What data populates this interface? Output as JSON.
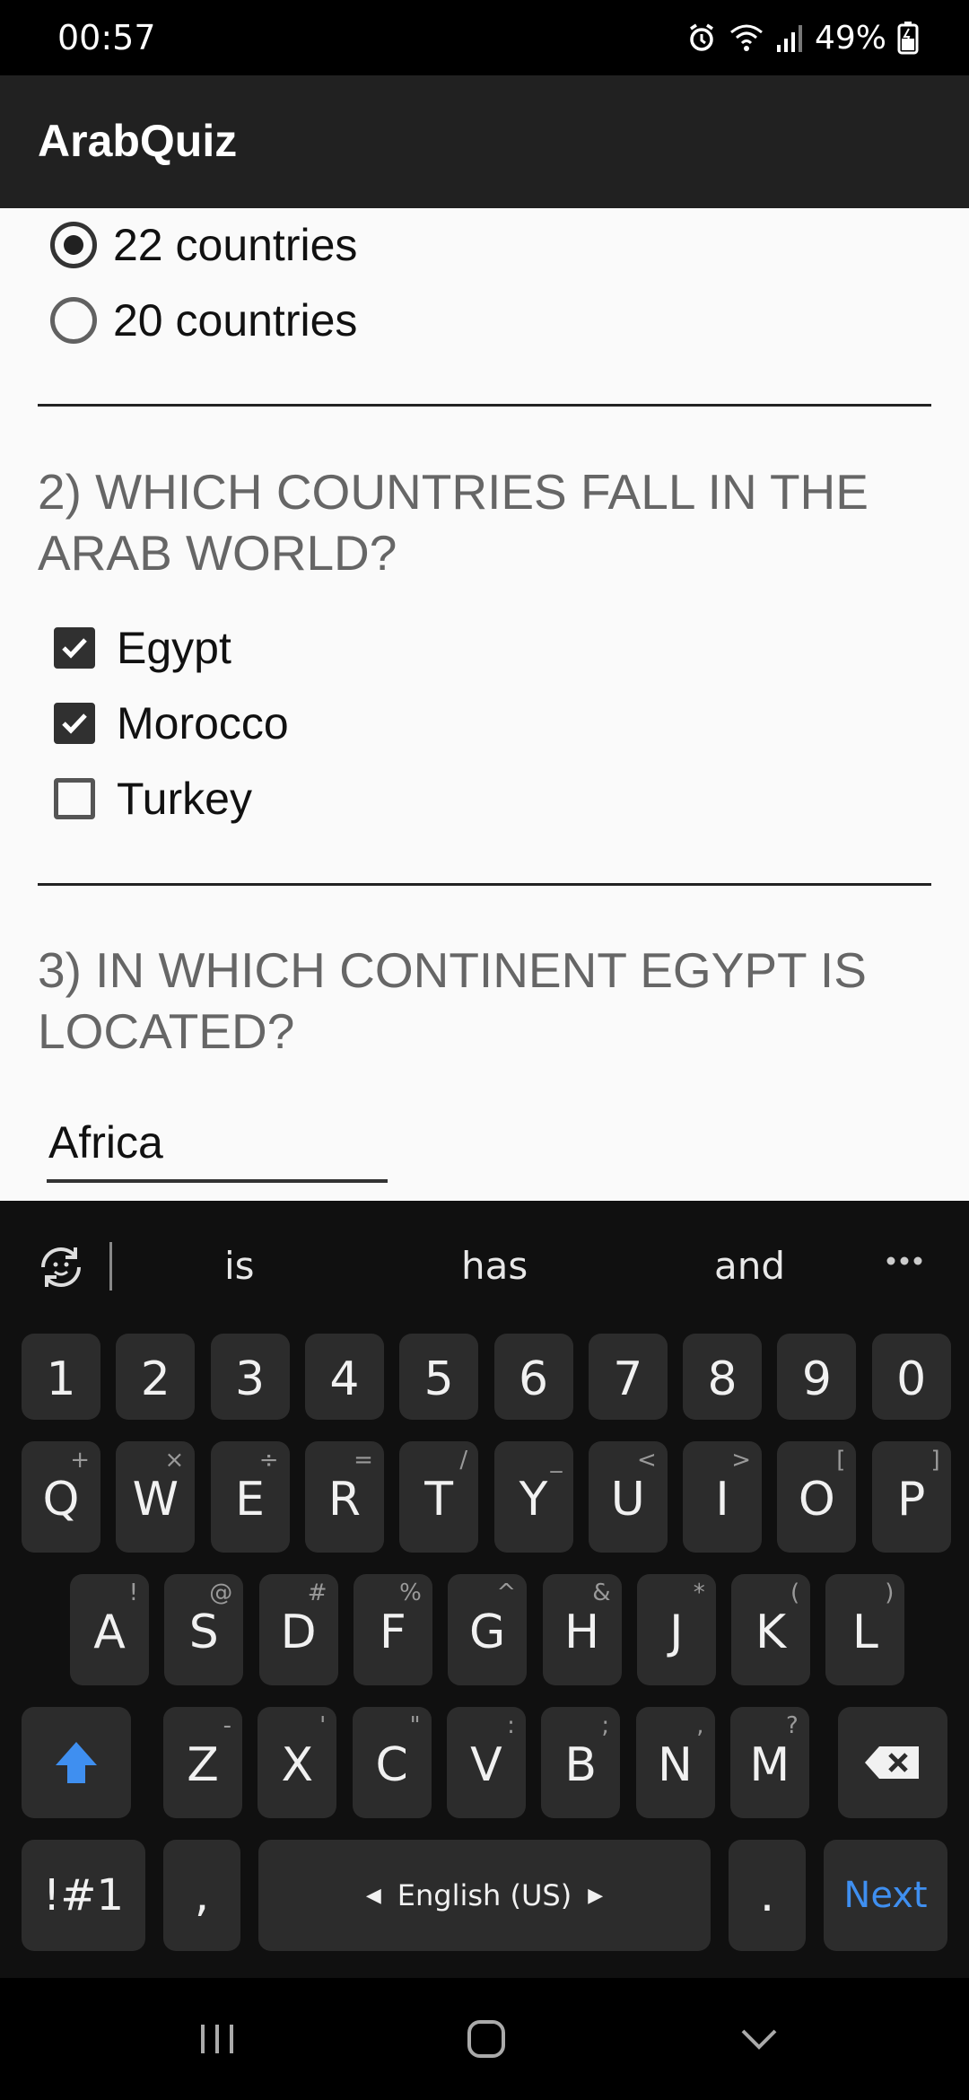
{
  "status_bar": {
    "time": "00:57",
    "battery_percent": "49%",
    "icons": [
      "alarm-icon",
      "wifi-icon",
      "signal-icon",
      "battery-icon"
    ]
  },
  "app_bar": {
    "title": "ArabQuiz"
  },
  "quiz": {
    "q1": {
      "options": [
        {
          "label": "22 countries",
          "selected": true
        },
        {
          "label": "20 countries",
          "selected": false
        }
      ]
    },
    "q2": {
      "question": "2) WHICH COUNTRIES FALL IN THE ARAB WORLD?",
      "options": [
        {
          "label": "Egypt",
          "checked": true
        },
        {
          "label": "Morocco",
          "checked": true
        },
        {
          "label": "Turkey",
          "checked": false
        }
      ]
    },
    "q3": {
      "question": "3) IN WHICH CONTINENT EGYPT IS LOCATED?",
      "answer": "Africa"
    }
  },
  "keyboard": {
    "suggestions": [
      "is",
      "has",
      "and"
    ],
    "number_row": [
      "1",
      "2",
      "3",
      "4",
      "5",
      "6",
      "7",
      "8",
      "9",
      "0"
    ],
    "row1": [
      {
        "k": "Q",
        "s": "+"
      },
      {
        "k": "W",
        "s": "×"
      },
      {
        "k": "E",
        "s": "÷"
      },
      {
        "k": "R",
        "s": "="
      },
      {
        "k": "T",
        "s": "/"
      },
      {
        "k": "Y",
        "s": "_"
      },
      {
        "k": "U",
        "s": "<"
      },
      {
        "k": "I",
        "s": ">"
      },
      {
        "k": "O",
        "s": "["
      },
      {
        "k": "P",
        "s": "]"
      }
    ],
    "row2": [
      {
        "k": "A",
        "s": "!"
      },
      {
        "k": "S",
        "s": "@"
      },
      {
        "k": "D",
        "s": "#"
      },
      {
        "k": "F",
        "s": "%"
      },
      {
        "k": "G",
        "s": "^"
      },
      {
        "k": "H",
        "s": "&"
      },
      {
        "k": "J",
        "s": "*"
      },
      {
        "k": "K",
        "s": "("
      },
      {
        "k": "L",
        "s": ")"
      }
    ],
    "row3": [
      {
        "k": "Z",
        "s": "-"
      },
      {
        "k": "X",
        "s": "'"
      },
      {
        "k": "C",
        "s": "\""
      },
      {
        "k": "V",
        "s": ":"
      },
      {
        "k": "B",
        "s": ";"
      },
      {
        "k": "N",
        "s": ","
      },
      {
        "k": "M",
        "s": "?"
      }
    ],
    "symbols_label": "!#1",
    "comma_label": ",",
    "space_label": "English (US)",
    "period_label": ".",
    "next_label": "Next"
  }
}
